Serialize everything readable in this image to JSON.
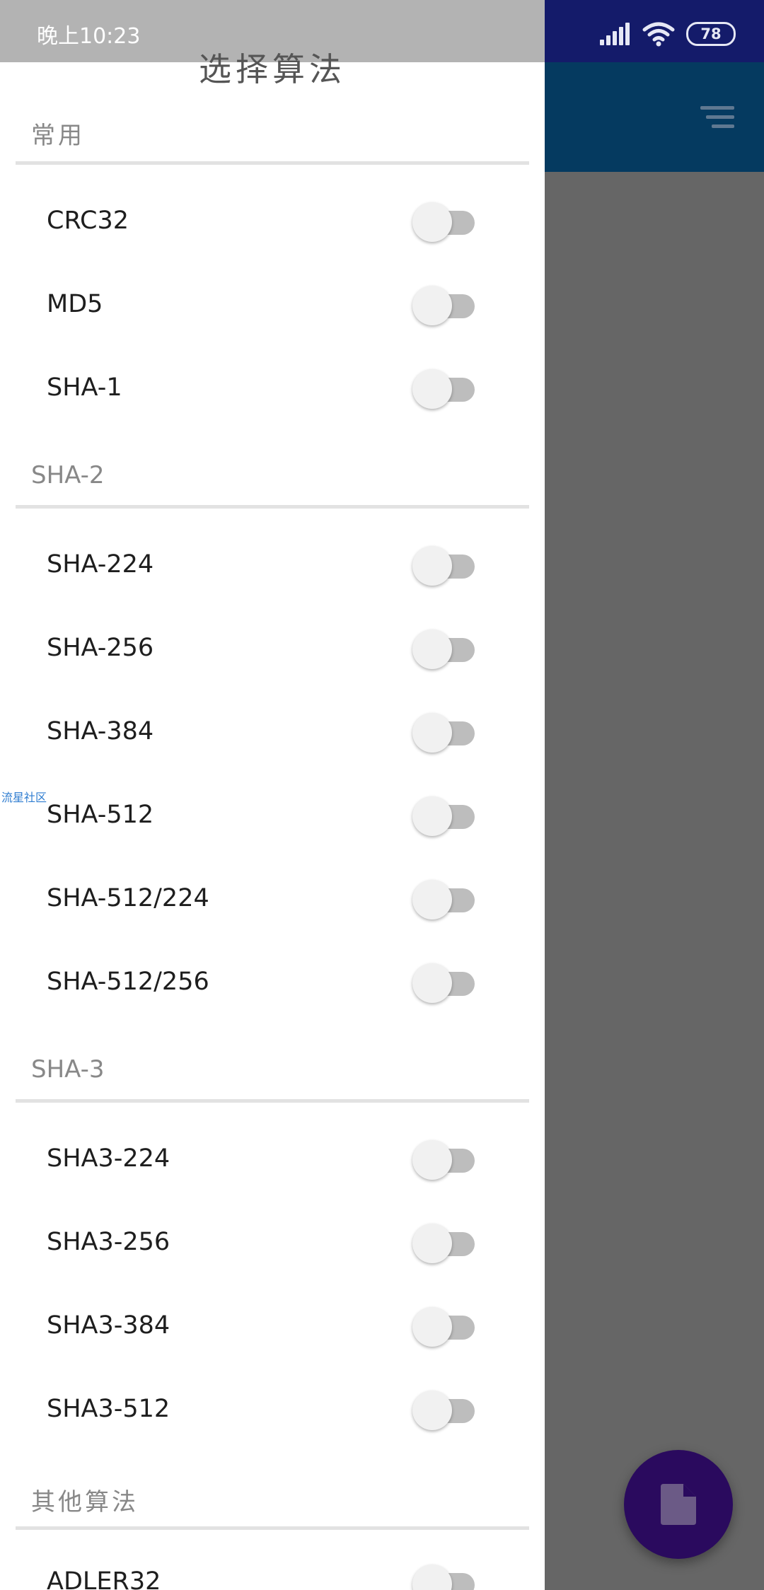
{
  "status_bar": {
    "time": "晚上10:23",
    "battery": "78"
  },
  "drawer": {
    "title": "选择算法",
    "sections": [
      {
        "header": "常用",
        "items": [
          {
            "label": "CRC32",
            "enabled": false
          },
          {
            "label": "MD5",
            "enabled": false
          },
          {
            "label": "SHA-1",
            "enabled": false
          }
        ]
      },
      {
        "header": "SHA-2",
        "items": [
          {
            "label": "SHA-224",
            "enabled": false
          },
          {
            "label": "SHA-256",
            "enabled": false
          },
          {
            "label": "SHA-384",
            "enabled": false
          },
          {
            "label": "SHA-512",
            "enabled": false
          },
          {
            "label": "SHA-512/224",
            "enabled": false
          },
          {
            "label": "SHA-512/256",
            "enabled": false
          }
        ]
      },
      {
        "header": "SHA-3",
        "items": [
          {
            "label": "SHA3-224",
            "enabled": false
          },
          {
            "label": "SHA3-256",
            "enabled": false
          },
          {
            "label": "SHA3-384",
            "enabled": false
          },
          {
            "label": "SHA3-512",
            "enabled": false
          }
        ]
      },
      {
        "header": "其他算法",
        "items": [
          {
            "label": "ADLER32",
            "enabled": false
          }
        ]
      }
    ]
  },
  "watermark": "流星社区",
  "colors": {
    "status_bar": "#141b6a",
    "toolbar": "#053a60",
    "fab": "#2a0a5e",
    "drawer_status_overlay": "#b3b3b3"
  },
  "icons": {
    "toolbar_menu": "sort-icon",
    "fab": "file-icon"
  }
}
